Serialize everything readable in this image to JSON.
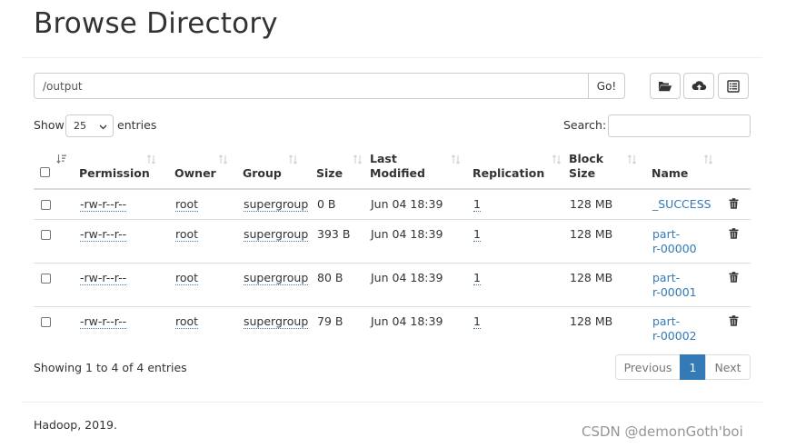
{
  "page": {
    "title": "Browse Directory"
  },
  "toolbar": {
    "path_value": "/output",
    "go_label": "Go!",
    "icons": [
      "folder-open-icon",
      "cloud-upload-icon",
      "list-alt-icon"
    ]
  },
  "controls": {
    "show_label": "Show",
    "entries_value": "25",
    "entries_label": "entries",
    "search_label": "Search:"
  },
  "table": {
    "headers": {
      "permission": "Permission",
      "owner": "Owner",
      "group": "Group",
      "size": "Size",
      "last_modified_1": "Last",
      "last_modified_2": "Modified",
      "replication": "Replication",
      "block_size_1": "Block",
      "block_size_2": "Size",
      "name": "Name"
    },
    "rows": [
      {
        "permission": "-rw-r--r--",
        "owner": "root",
        "group": "supergroup",
        "size": "0 B",
        "modified": "Jun 04 18:39",
        "replication": "1",
        "block_size": "128 MB",
        "name": "_SUCCESS",
        "name_1": "_SUCCESS",
        "name_2": ""
      },
      {
        "permission": "-rw-r--r--",
        "owner": "root",
        "group": "supergroup",
        "size": "393 B",
        "modified": "Jun 04 18:39",
        "replication": "1",
        "block_size": "128 MB",
        "name": "part-r-00000",
        "name_1": "part-",
        "name_2": "r-00000"
      },
      {
        "permission": "-rw-r--r--",
        "owner": "root",
        "group": "supergroup",
        "size": "80 B",
        "modified": "Jun 04 18:39",
        "replication": "1",
        "block_size": "128 MB",
        "name": "part-r-00001",
        "name_1": "part-",
        "name_2": "r-00001"
      },
      {
        "permission": "-rw-r--r--",
        "owner": "root",
        "group": "supergroup",
        "size": "79 B",
        "modified": "Jun 04 18:39",
        "replication": "1",
        "block_size": "128 MB",
        "name": "part-r-00002",
        "name_1": "part-",
        "name_2": "r-00002"
      }
    ]
  },
  "info": {
    "showing": "Showing 1 to 4 of 4 entries"
  },
  "pagination": {
    "previous": "Previous",
    "current": "1",
    "next": "Next"
  },
  "footer": {
    "text": "Hadoop, 2019."
  },
  "watermark": {
    "text": "CSDN @demonGoth'boi"
  },
  "colors": {
    "link": "#337ab7",
    "active_page": "#337ab7",
    "border": "#dddddd"
  }
}
